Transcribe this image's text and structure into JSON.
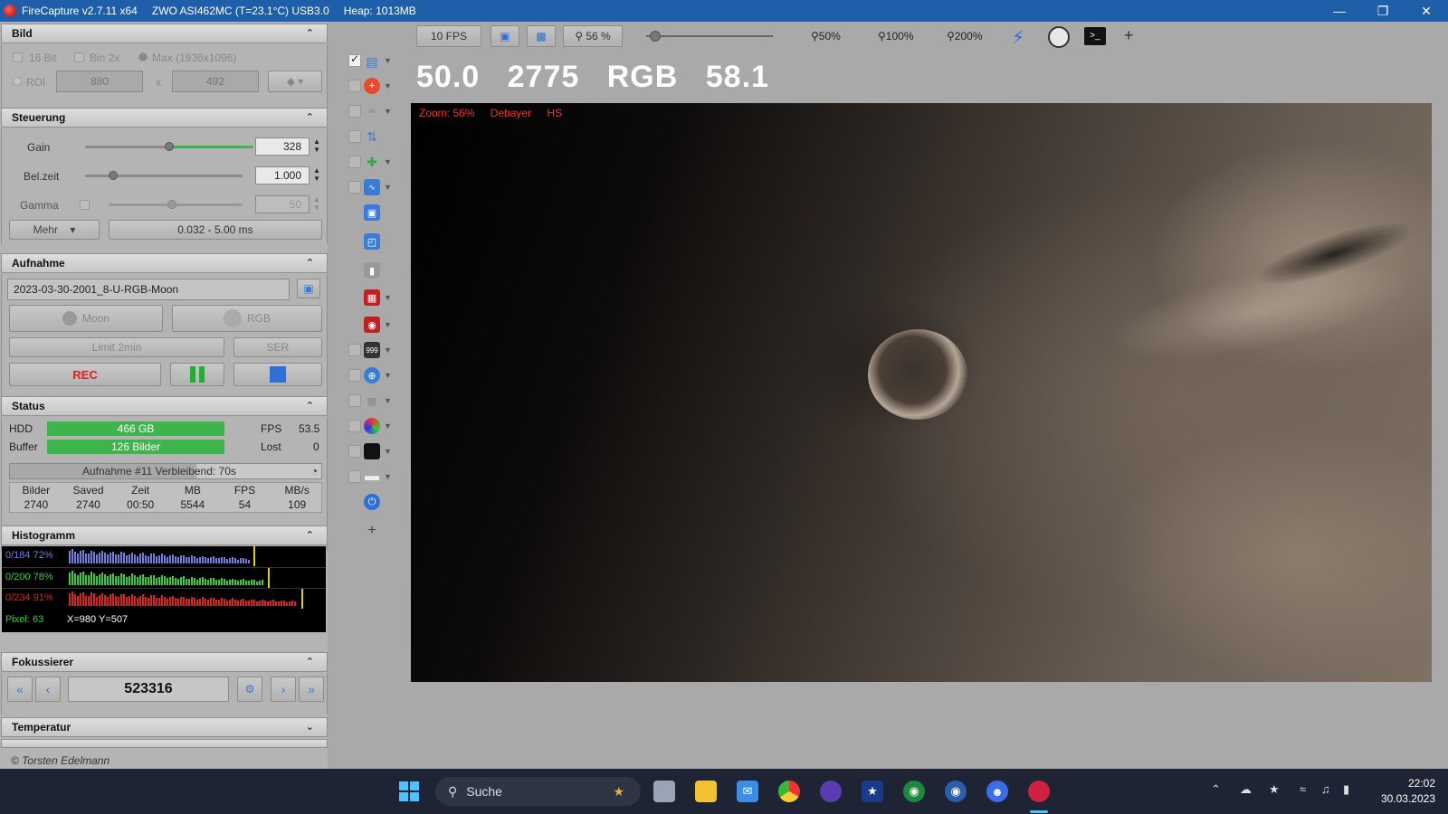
{
  "titlebar": {
    "app": "FireCapture v2.7.11 x64",
    "camera": "ZWO ASI462MC (T=23.1°C) USB3.0",
    "heap": "Heap: 1013MB"
  },
  "bild": {
    "title": "Bild",
    "bit16": "16 Bit",
    "bin2x": "Bin 2x",
    "max": "Max (1936x1096)",
    "roi": "ROI",
    "roi_w": "880",
    "roi_x": "x",
    "roi_h": "492"
  },
  "steuerung": {
    "title": "Steuerung",
    "gain_label": "Gain",
    "gain_value": "328",
    "gain_fraction": 0.5,
    "belzeit_label": "Bel.zeit",
    "belzeit_value": "1.000",
    "belzeit_fraction": 0.18,
    "gamma_label": "Gamma",
    "gamma_value": "50",
    "gamma_fraction": 0.5,
    "mehr": "Mehr",
    "range": "0.032 - 5.00 ms"
  },
  "aufnahme": {
    "title": "Aufnahme",
    "filename": "2023-03-30-2001_8-U-RGB-Moon",
    "moon": "Moon",
    "rgb": "RGB",
    "limit": "Limit 2min",
    "ser": "SER",
    "rec": "REC"
  },
  "status": {
    "title": "Status",
    "hdd_label": "HDD",
    "hdd_value": "466 GB",
    "fps_label": "FPS",
    "fps_value": "53.5",
    "buffer_label": "Buffer",
    "buffer_value": "126 Bilder",
    "lost_label": "Lost",
    "lost_value": "0",
    "progress_text": "Aufnahme #11   Verbleibend: 70s",
    "progress_fraction": 0.6,
    "headers": [
      "Bilder",
      "Saved",
      "Zeit",
      "MB",
      "FPS",
      "MB/s"
    ],
    "values": [
      "2740",
      "2740",
      "00:50",
      "5544",
      "54",
      "109"
    ]
  },
  "histogramm": {
    "title": "Histogramm",
    "rows": [
      {
        "label": "0/184 72%",
        "color": "#6f7fe0",
        "fraction": 0.72
      },
      {
        "label": "0/200 78%",
        "color": "#2fd03a",
        "fraction": 0.78
      },
      {
        "label": "0/234 91%",
        "color": "#e02020",
        "fraction": 0.91
      }
    ],
    "pixel": "Pixel: 63",
    "coords": "X=980 Y=507"
  },
  "fokussierer": {
    "title": "Fokussierer",
    "position": "523316"
  },
  "temperatur": {
    "title": "Temperatur"
  },
  "toolbar": {
    "fps_button": "10 FPS",
    "zoom_value": "56 %",
    "zoom_50": "50%",
    "zoom_100": "100%",
    "zoom_200": "200%",
    "plus": "+"
  },
  "readout": {
    "v1": "50.0",
    "v2": "2775",
    "v3": "RGB",
    "v4": "58.1"
  },
  "view": {
    "zoom": "Zoom: 56%",
    "debayer": "Debayer",
    "hs": "HS"
  },
  "copyright": "© Torsten Edelmann",
  "taskbar": {
    "search": "Suche",
    "time": "22:02",
    "date": "30.03.2023"
  },
  "colors": {
    "titlebar": "#1f5ea8",
    "green_bar": "#3eb54a",
    "rec_red": "#e02020",
    "info_red": "#ff2a2a"
  }
}
